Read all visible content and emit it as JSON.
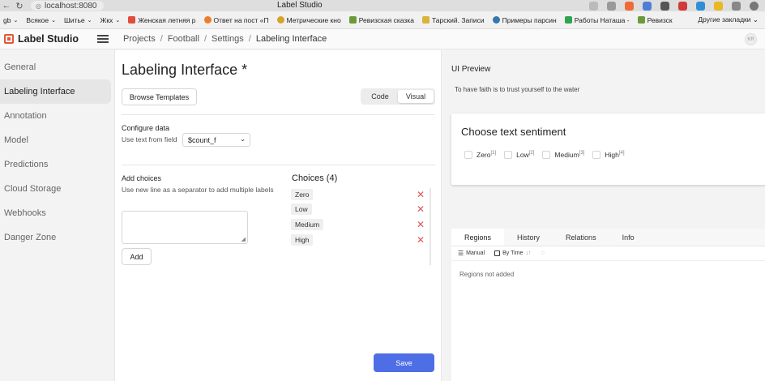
{
  "browser": {
    "url": "localhost:8080",
    "window_title": "Label Studio",
    "bookmarks": [
      "gb",
      "Всякое",
      "Шитье",
      "Жкх",
      "Женская летняя р",
      "Ответ на пост «П",
      "Метрические кно",
      "Ревизская сказка",
      "Тарский. Записи",
      "Примеры парсин",
      "Работы Наташа -",
      "Ревизск"
    ],
    "other_bookmarks": "Другие закладки"
  },
  "app": {
    "logo": "Label Studio",
    "breadcrumb": [
      "Projects",
      "Football",
      "Settings",
      "Labeling Interface"
    ],
    "avatar_initials": "KR"
  },
  "sidebar": {
    "items": [
      {
        "label": "General"
      },
      {
        "label": "Labeling Interface",
        "active": true
      },
      {
        "label": "Annotation"
      },
      {
        "label": "Model"
      },
      {
        "label": "Predictions"
      },
      {
        "label": "Cloud Storage"
      },
      {
        "label": "Webhooks"
      },
      {
        "label": "Danger Zone"
      }
    ]
  },
  "main": {
    "title": "Labeling Interface *",
    "browse_templates": "Browse Templates",
    "view_toggle": {
      "code": "Code",
      "visual": "Visual",
      "selected": "Visual"
    },
    "configure_data": {
      "heading": "Configure data",
      "field_label": "Use text from field",
      "field_value": "$count_f"
    },
    "add_choices": {
      "heading": "Add choices",
      "hint": "Use new line as a separator to add multiple labels",
      "textarea_value": "",
      "add_button": "Add"
    },
    "choices": {
      "title": "Choices (4)",
      "items": [
        "Zero",
        "Low",
        "Medium",
        "High"
      ]
    },
    "save_button": "Save"
  },
  "preview": {
    "title": "UI Preview",
    "text": "To have faith is to trust yourself to the water",
    "question": "Choose text sentiment",
    "options": [
      {
        "label": "Zero",
        "hotkey": "[1]"
      },
      {
        "label": "Low",
        "hotkey": "[2]"
      },
      {
        "label": "Medium",
        "hotkey": "[3]"
      },
      {
        "label": "High",
        "hotkey": "[4]"
      }
    ],
    "tabs": [
      "Regions",
      "History",
      "Relations",
      "Info"
    ],
    "tools": {
      "manual": "Manual",
      "by_time": "By Time"
    },
    "empty_text": "Regions not added"
  },
  "colors": {
    "accent": "#4e6ee6",
    "brand": "#e3573a",
    "delete": "#e05656"
  }
}
